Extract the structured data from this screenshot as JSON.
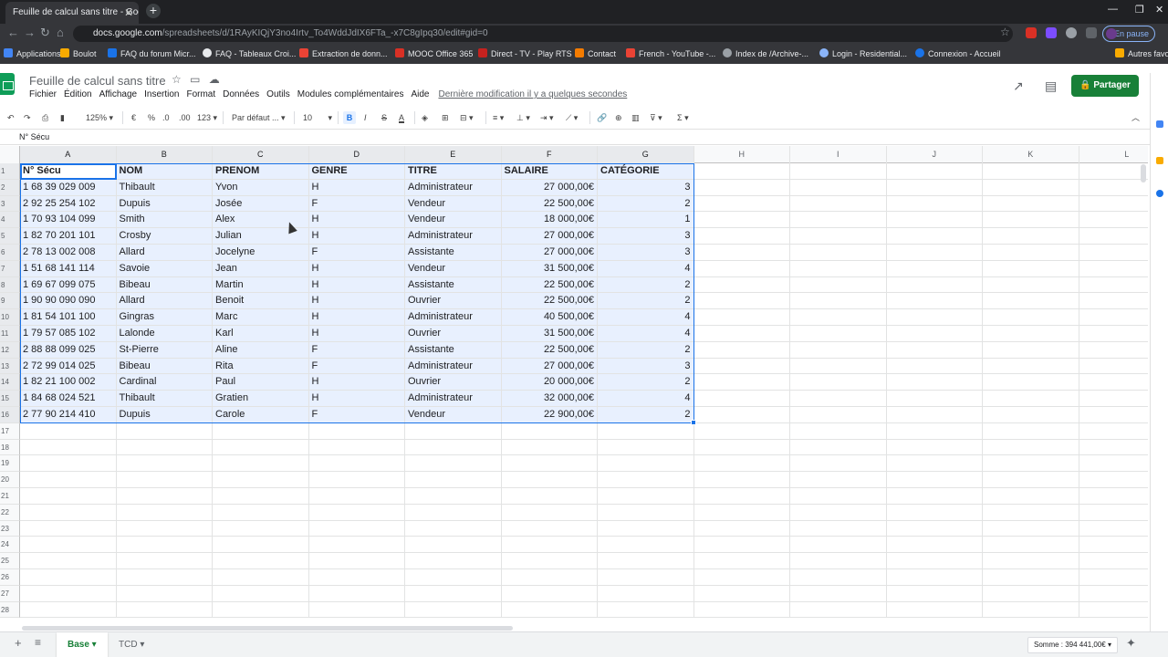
{
  "browser": {
    "tab_title": "Feuille de calcul sans titre - Goo",
    "url_host": "docs.google.com",
    "url_path": "/spreadsheets/d/1RAyKIQjY3no4Irtv_To4WddJdIX6FTa_-x7C8gIpq30/edit#gid=0",
    "profile_label": "En pause",
    "bookmarks": [
      "Applications",
      "Boulot",
      "FAQ du forum Micr...",
      "FAQ - Tableaux Croi...",
      "Extraction de donn...",
      "MOOC Office 365",
      "Direct - TV - Play RTS",
      "Contact",
      "French - YouTube -...",
      "Index de /Archive-...",
      "Login - Residential...",
      "Connexion - Accueil",
      "Autres favo"
    ]
  },
  "sheets": {
    "doc_title": "Feuille de calcul sans titre",
    "menus": [
      "Fichier",
      "Édition",
      "Affichage",
      "Insertion",
      "Format",
      "Données",
      "Outils",
      "Modules complémentaires",
      "Aide"
    ],
    "last_edit": "Dernière modification il y a quelques secondes",
    "share_label": "Partager",
    "toolbar": {
      "zoom": "125%",
      "currency": "€",
      "percent": "%",
      "dec_less": ".0",
      "dec_more": ".00",
      "format_more": "123",
      "font": "Par défaut ...",
      "font_size": "10",
      "bold": "B",
      "italic": "I",
      "strike": "S",
      "textcolor": "A",
      "sum": "Σ"
    },
    "formula_value": "N° Sécu",
    "columns": [
      "A",
      "B",
      "C",
      "D",
      "E",
      "F",
      "G",
      "H",
      "I",
      "J",
      "K",
      "L"
    ],
    "headers": [
      "N° Sécu",
      "NOM",
      "PRENOM",
      "GENRE",
      "TITRE",
      "SALAIRE",
      "CATÉGORIE"
    ],
    "rows": [
      [
        "1 68 39 029 009",
        "Thibault",
        "Yvon",
        "H",
        "Administrateur",
        "27 000,00€",
        "3"
      ],
      [
        "2 92 25 254 102",
        "Dupuis",
        "Josée",
        "F",
        "Vendeur",
        "22 500,00€",
        "2"
      ],
      [
        "1 70 93 104 099",
        "Smith",
        "Alex",
        "H",
        "Vendeur",
        "18 000,00€",
        "1"
      ],
      [
        "1 82 70 201 101",
        "Crosby",
        "Julian",
        "H",
        "Administrateur",
        "27 000,00€",
        "3"
      ],
      [
        "2 78 13 002 008",
        "Allard",
        "Jocelyne",
        "F",
        "Assistante",
        "27 000,00€",
        "3"
      ],
      [
        "1 51 68 141 114",
        "Savoie",
        "Jean",
        "H",
        "Vendeur",
        "31 500,00€",
        "4"
      ],
      [
        "1 69 67 099 075",
        "Bibeau",
        "Martin",
        "H",
        "Assistante",
        "22 500,00€",
        "2"
      ],
      [
        "1 90 90 090 090",
        "Allard",
        "Benoit",
        "H",
        "Ouvrier",
        "22 500,00€",
        "2"
      ],
      [
        "1 81 54 101 100",
        "Gingras",
        "Marc",
        "H",
        "Administrateur",
        "40 500,00€",
        "4"
      ],
      [
        "1 79 57 085 102",
        "Lalonde",
        "Karl",
        "H",
        "Ouvrier",
        "31 500,00€",
        "4"
      ],
      [
        "2 88 88 099 025",
        "St-Pierre",
        "Aline",
        "F",
        "Assistante",
        "22 500,00€",
        "2"
      ],
      [
        "2 72 99 014 025",
        "Bibeau",
        "Rita",
        "F",
        "Administrateur",
        "27 000,00€",
        "3"
      ],
      [
        "1 82 21 100 002",
        "Cardinal",
        "Paul",
        "H",
        "Ouvrier",
        "20 000,00€",
        "2"
      ],
      [
        "1 84 68 024 521",
        "Thibault",
        "Gratien",
        "H",
        "Administrateur",
        "32 000,00€",
        "4"
      ],
      [
        "2 77 90 214 410",
        "Dupuis",
        "Carole",
        "F",
        "Vendeur",
        "22 900,00€",
        "2"
      ]
    ],
    "row_numbers": [
      "1",
      "2",
      "3",
      "4",
      "5",
      "6",
      "7",
      "8",
      "9",
      "10",
      "11",
      "12",
      "13",
      "14",
      "15",
      "16",
      "17",
      "18",
      "19",
      "20",
      "21",
      "22",
      "23",
      "24",
      "25",
      "26",
      "27",
      "28"
    ],
    "sheet_tabs": [
      {
        "label": "Base",
        "active": true
      },
      {
        "label": "TCD",
        "active": false
      }
    ],
    "sum_label": "Somme : 394 441,00€"
  }
}
